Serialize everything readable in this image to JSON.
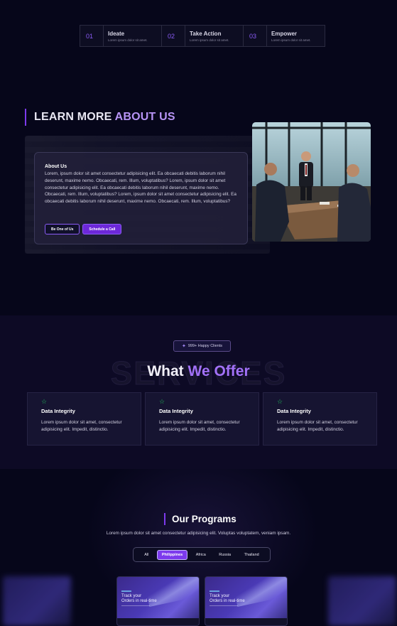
{
  "steps": [
    {
      "num": "01",
      "title": "Ideate",
      "desc": "Lorem ipsum dolor sit amet."
    },
    {
      "num": "02",
      "title": "Take Action",
      "desc": "Lorem ipsum dolor sit amet."
    },
    {
      "num": "03",
      "title": "Empower",
      "desc": "Lorem ipsum dolor sit amet."
    }
  ],
  "about": {
    "heading_plain": "LEARN MORE ",
    "heading_highlight": "ABOUT US",
    "card_title": "About Us",
    "card_text": "Lorem, ipsum dolor sit amet consectetur adipisicing elit. Ea obcaecati debitis laborum nihil deserunt, maxime nemo. Obcaecati, rem. Illum, voluptatibus? Lorem, ipsum dolor sit amet consectetur adipisicing elit. Ea obcaecati debitis laborum nihil deserunt, maxime nemo. Obcaecati, rem. Illum, voluptatibus? Lorem, ipsum dolor sit amet consectetur adipisicing elit. Ea obcaecati debitis laborum nihil deserunt, maxime nemo. Obcaecati, rem. Illum, voluptatibus?",
    "btn_join": "Be One of Us",
    "btn_call": "Schedule a Call"
  },
  "services": {
    "badge": "999+ Happy Clients",
    "ghost_word": "SERVICES",
    "title_plain": "What ",
    "title_highlight": "We Offer",
    "cards": [
      {
        "title": "Data Integrity",
        "text": "Lorem ipsum dolor sit amet, consectetur adipisicing elit. Impedit, distinctio."
      },
      {
        "title": "Data Integrity",
        "text": "Lorem ipsum dolor sit amet, consectetur adipisicing elit. Impedit, distinctio."
      },
      {
        "title": "Data Integrity",
        "text": "Lorem ipsum dolor sit amet, consectetur adipisicing elit. Impedit, distinctio."
      }
    ]
  },
  "programs": {
    "heading": "Our Programs",
    "subtitle": "Lorem ipsum dolor sit amet consectetur adipisicing elit. Voluptas voluptatem, veniam ipsam.",
    "tabs": [
      "All",
      "Philippines",
      "Africa",
      "Russia",
      "Thailand"
    ],
    "active_tab": "Philippines",
    "cards": [
      {
        "title_line1": "Track your",
        "title_line2": "Orders in real-time"
      },
      {
        "title_line1": "Track your",
        "title_line2": "Orders in real-time"
      }
    ]
  },
  "colors": {
    "accent": "#8b5cf6",
    "highlight": "#a271f8",
    "background": "#06061a",
    "service_icon": "#22c55e"
  },
  "icons": {
    "badge": "sparkle-icon",
    "service": "star-icon"
  }
}
